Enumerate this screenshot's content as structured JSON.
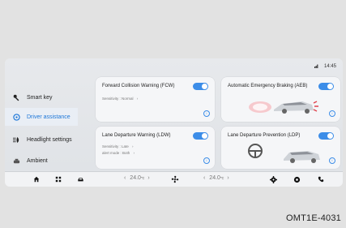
{
  "status": {
    "signal_icon": "signal-icon",
    "time": "14:45"
  },
  "sidebar": {
    "items": [
      {
        "label": "Smart key",
        "icon": "key-icon"
      },
      {
        "label": "Driver assistance",
        "icon": "steering-icon",
        "active": true
      },
      {
        "label": "Headlight settings",
        "icon": "headlight-icon"
      },
      {
        "label": "Ambient",
        "icon": "light-icon"
      }
    ]
  },
  "cards": {
    "fcw": {
      "title": "Forward Collision Warning (FCW)",
      "sensitivity": "Sensitivity : Normal",
      "arrow": "›"
    },
    "aeb": {
      "title": "Automatic Emergency Braking (AEB)"
    },
    "ldw": {
      "title": "Lane Departure Warning (LDW)",
      "sensitivity": "Sensitivity : Late",
      "alert": "alert mode : Both",
      "arrow": "›"
    },
    "ldp": {
      "title": "Lane Departure Prevention (LDP)"
    }
  },
  "bottom": {
    "temp_left": "24.0",
    "temp_right": "24.0",
    "temp_unit": "℃",
    "left_arrow": "‹",
    "right_arrow": "›"
  },
  "caption": "OMT1E-4031",
  "colors": {
    "accent": "#3c8de8",
    "active_bg": "#e9eef5"
  }
}
